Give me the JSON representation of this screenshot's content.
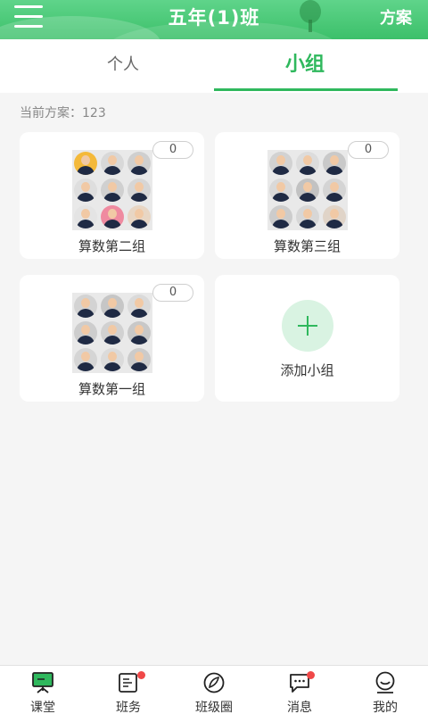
{
  "header": {
    "title": "五年(1)班",
    "action": "方案"
  },
  "tabs": [
    {
      "label": "个人",
      "active": false
    },
    {
      "label": "小组",
      "active": true
    }
  ],
  "plan_label": "当前方案：123",
  "groups": [
    {
      "name": "算数第二组",
      "count": "0"
    },
    {
      "name": "算数第三组",
      "count": "0"
    },
    {
      "name": "算数第一组",
      "count": "0"
    }
  ],
  "add_group_label": "添加小组",
  "bottom_nav": [
    {
      "label": "课堂",
      "icon": "classroom-icon",
      "active": true
    },
    {
      "label": "班务",
      "icon": "class-affairs-icon",
      "badge": true
    },
    {
      "label": "班级圈",
      "icon": "class-circle-icon"
    },
    {
      "label": "消息",
      "icon": "message-icon",
      "badge": true
    },
    {
      "label": "我的",
      "icon": "profile-icon"
    }
  ],
  "colors": {
    "accent": "#2fb85d",
    "header": "#3cc06a",
    "badge": "#f04848"
  }
}
